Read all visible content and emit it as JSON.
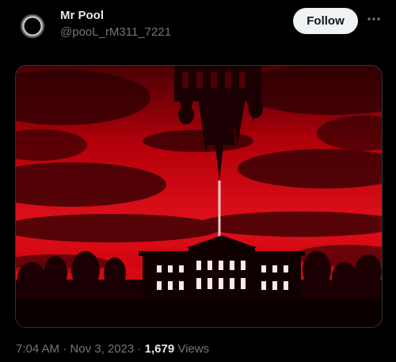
{
  "author": {
    "display_name": "Mr Pool",
    "handle": "@pooL_rM311_7221"
  },
  "actions": {
    "follow_label": "Follow",
    "more_icon": "more-horizontal-icon"
  },
  "media": {
    "type": "image"
  },
  "meta": {
    "time": "7:04 AM",
    "separator": "·",
    "date": "Nov 3, 2023",
    "views_count": "1,679",
    "views_label": "Views"
  }
}
